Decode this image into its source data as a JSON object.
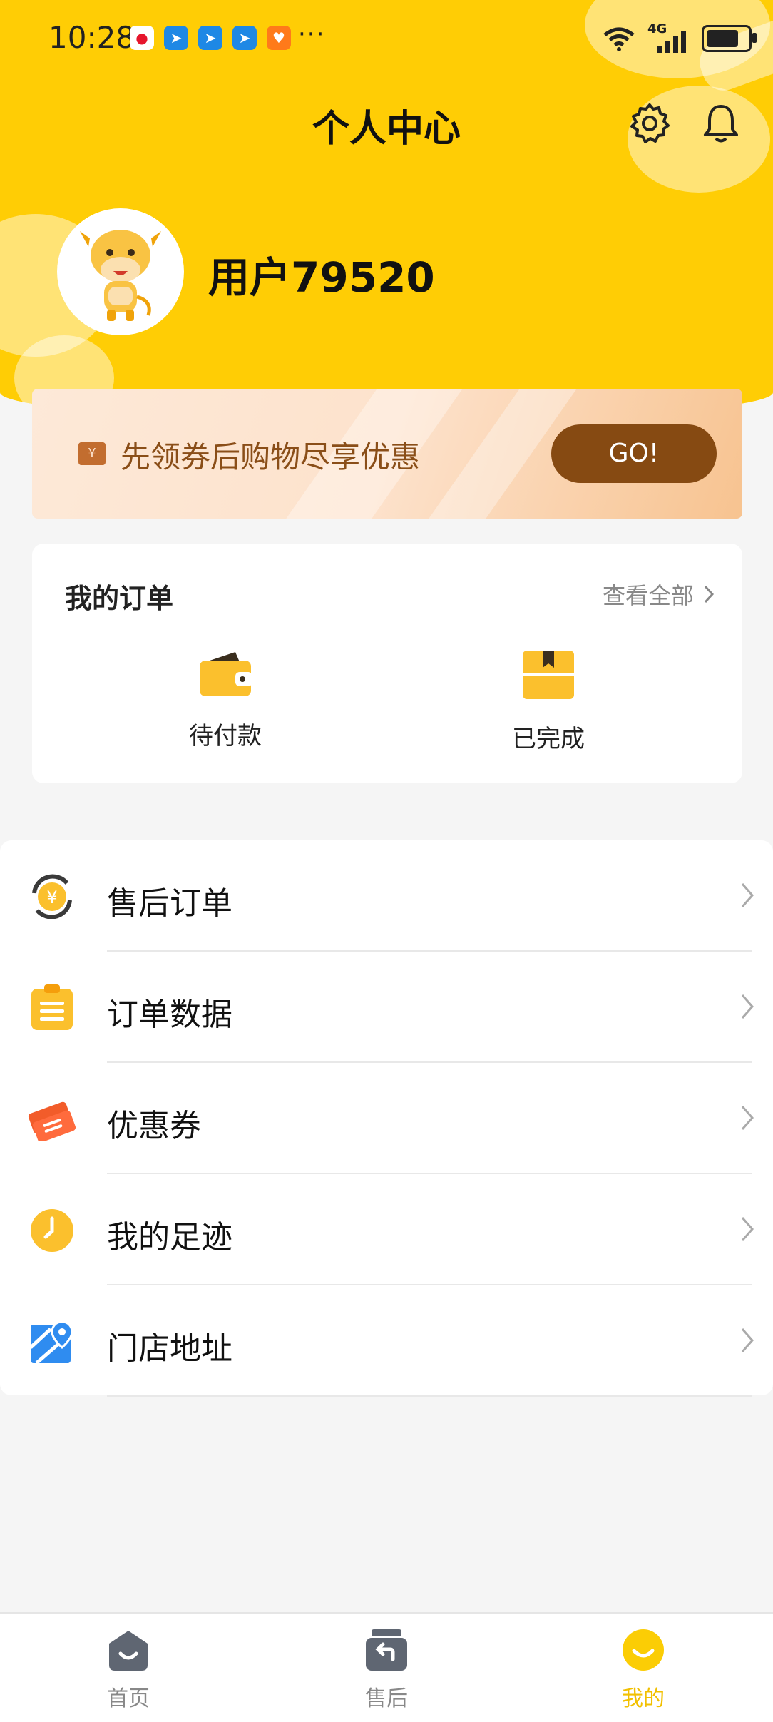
{
  "status_bar": {
    "time": "10:28",
    "network": "4G",
    "app_icons": [
      "weibo-icon",
      "app-icon-blue",
      "app-icon-blue",
      "app-icon-blue",
      "app-icon-orange"
    ],
    "more": "···"
  },
  "header": {
    "title": "个人中心",
    "settings_icon": "gear-icon",
    "notification_icon": "bell-icon"
  },
  "profile": {
    "username": "用户79520"
  },
  "promo": {
    "text": "先领券后购物尽享优惠",
    "button_label": "GO!"
  },
  "orders": {
    "title": "我的订单",
    "view_all": "查看全部",
    "items": [
      {
        "label": "待付款",
        "icon": "wallet-icon"
      },
      {
        "label": "已完成",
        "icon": "box-icon"
      }
    ]
  },
  "menu": {
    "items": [
      {
        "label": "售后订单",
        "icon": "refund-icon"
      },
      {
        "label": "订单数据",
        "icon": "clipboard-icon"
      },
      {
        "label": "优惠券",
        "icon": "coupon-icon"
      },
      {
        "label": "我的足迹",
        "icon": "clock-icon"
      },
      {
        "label": "门店地址",
        "icon": "map-pin-icon"
      }
    ]
  },
  "tabbar": {
    "items": [
      {
        "label": "首页",
        "icon": "home-icon"
      },
      {
        "label": "售后",
        "icon": "aftersale-icon"
      },
      {
        "label": "我的",
        "icon": "profile-icon",
        "active": true
      }
    ]
  },
  "colors": {
    "primary_yellow": "#ffcd05",
    "promo_button": "#864a12",
    "active_tab": "#f2c000"
  }
}
